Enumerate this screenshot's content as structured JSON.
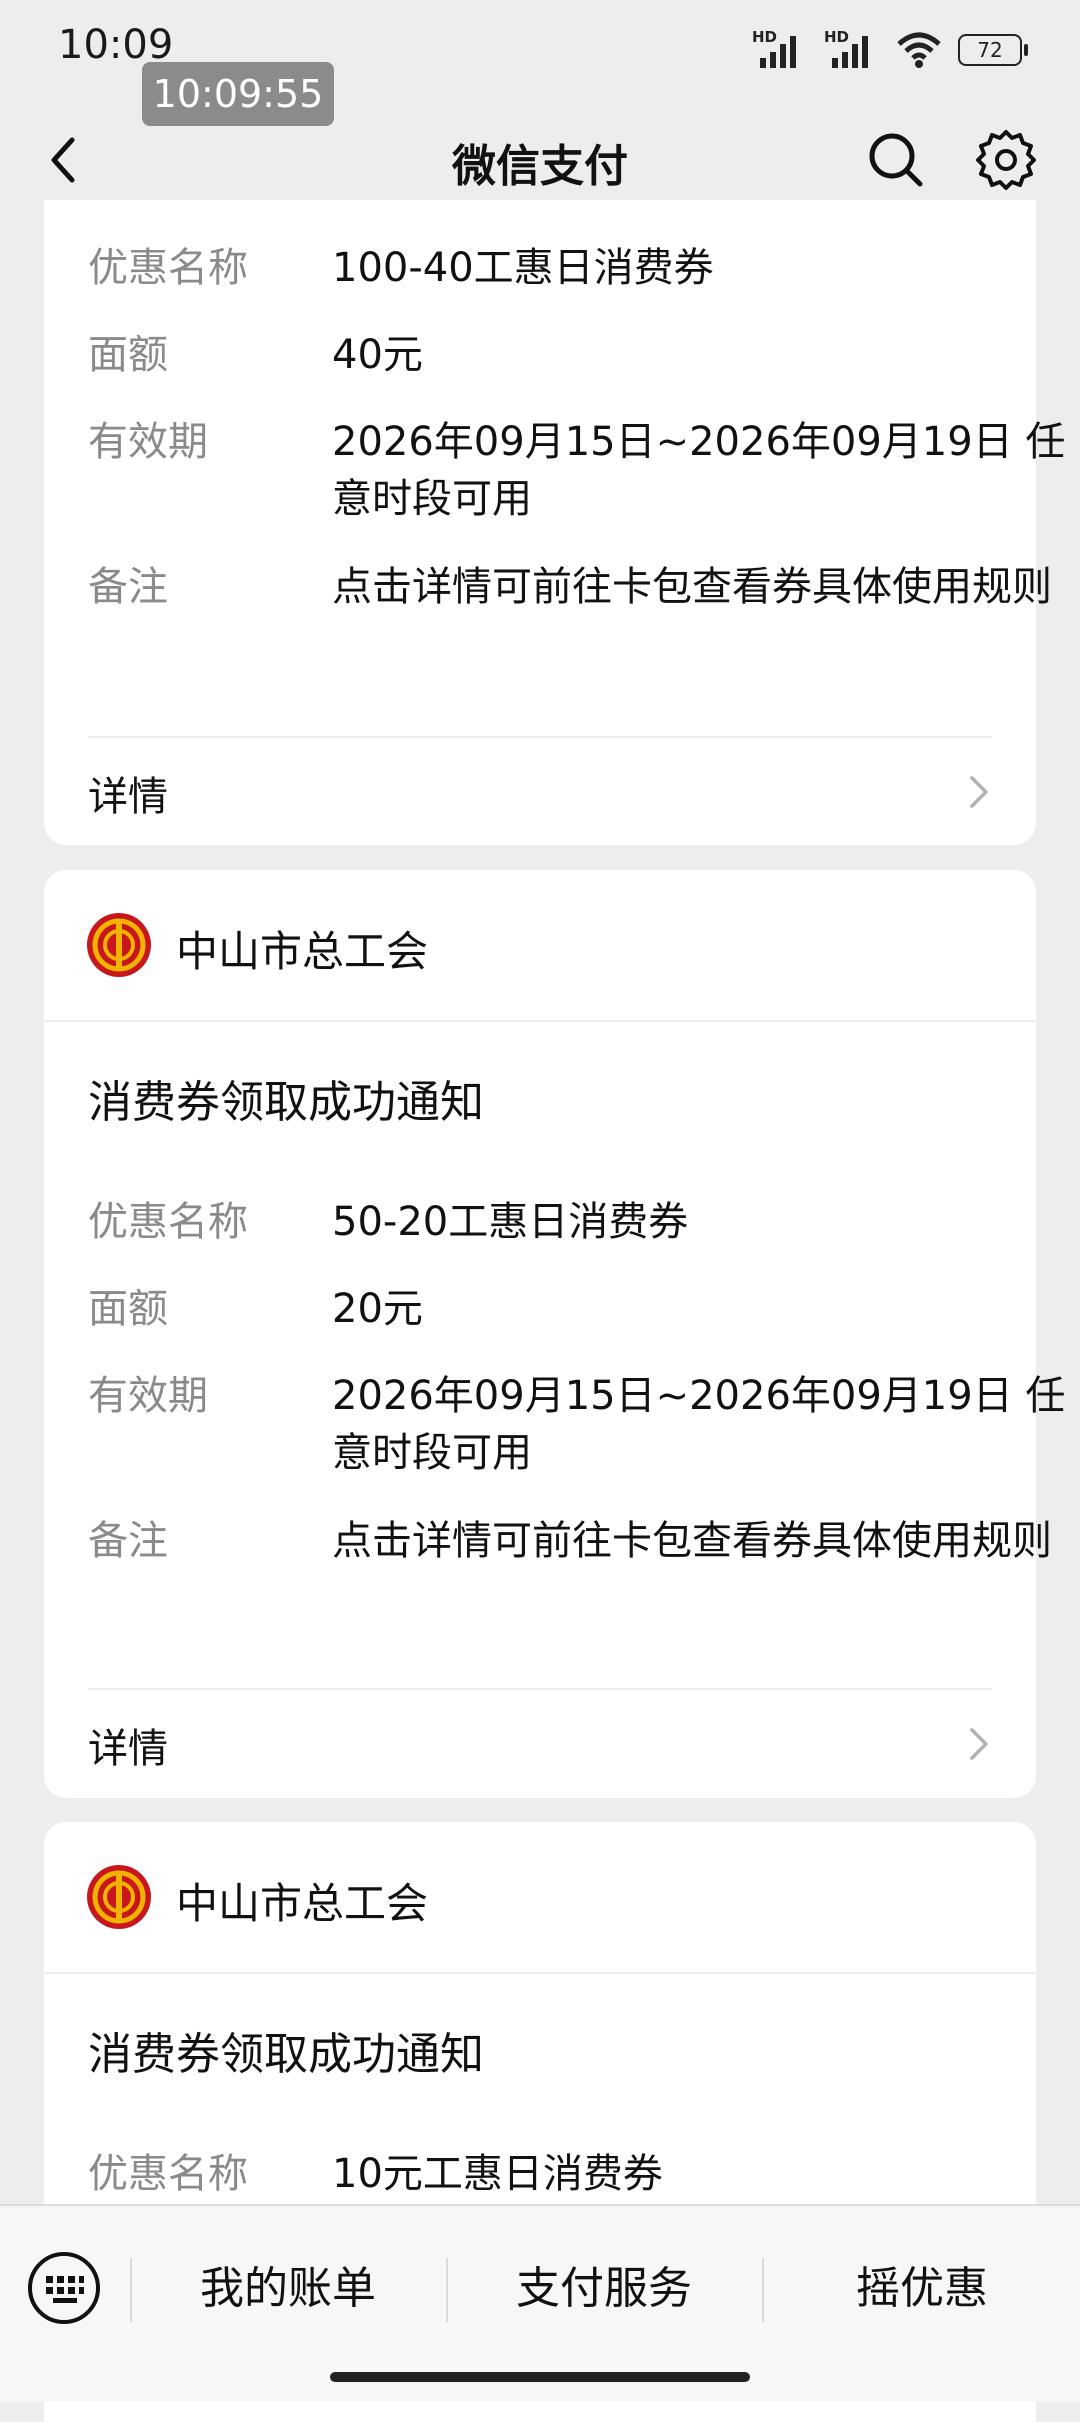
{
  "status": {
    "time": "10:09",
    "tooltip_time": "10:09:55",
    "hd1": "HD",
    "hd2": "HD",
    "battery": "72"
  },
  "header": {
    "title": "微信支付"
  },
  "cards": [
    {
      "fields": [
        {
          "label": "优惠名称",
          "value": "100-40工惠日消费券"
        },
        {
          "label": "面额",
          "value": "40元"
        },
        {
          "label": "有效期",
          "value": "2026年09月15日~2026年09月19日 任意时段可用"
        },
        {
          "label": "备注",
          "value": "点击详情可前往卡包查看券具体使用规则"
        }
      ],
      "detail_label": "详情"
    },
    {
      "sender": "中山市总工会",
      "notice_title": "消费券领取成功通知",
      "fields": [
        {
          "label": "优惠名称",
          "value": "50-20工惠日消费券"
        },
        {
          "label": "面额",
          "value": "20元"
        },
        {
          "label": "有效期",
          "value": "2026年09月15日~2026年09月19日 任意时段可用"
        },
        {
          "label": "备注",
          "value": "点击详情可前往卡包查看券具体使用规则"
        }
      ],
      "detail_label": "详情"
    },
    {
      "sender": "中山市总工会",
      "notice_title": "消费券领取成功通知",
      "fields": [
        {
          "label": "优惠名称",
          "value": "10元工惠日消费券"
        }
      ]
    }
  ],
  "bottom_menu": {
    "items": [
      "我的账单",
      "支付服务",
      "摇优惠"
    ]
  },
  "colors": {
    "logo_red": "#c8161d",
    "logo_gold": "#f2b300"
  }
}
